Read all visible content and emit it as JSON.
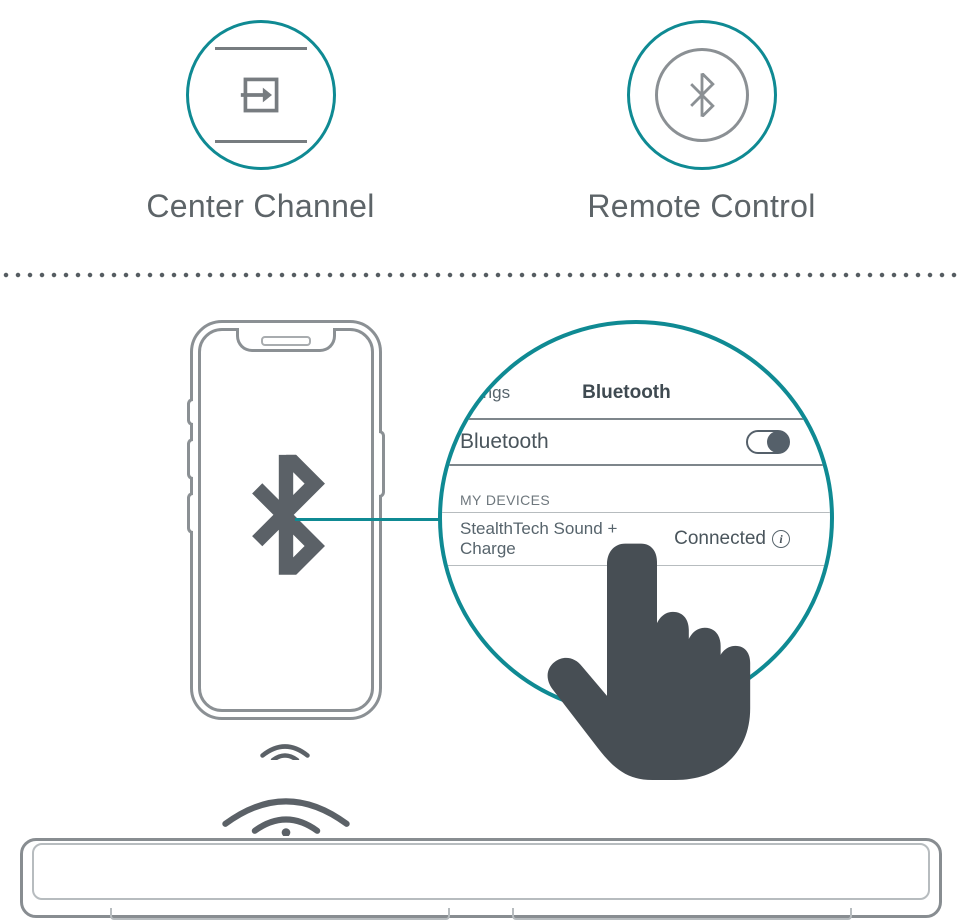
{
  "accent": "#0f8a93",
  "stroke": "#8b9094",
  "top": {
    "left": {
      "label": "Center Channel"
    },
    "right": {
      "label": "Remote Control"
    }
  },
  "bubble": {
    "back_label": "ettings",
    "title": "Bluetooth",
    "toggle_label": "Bluetooth",
    "toggle_on": true,
    "section_label": "MY DEVICES",
    "device_name": "StealthTech Sound + Charge",
    "device_status": "Connected"
  }
}
